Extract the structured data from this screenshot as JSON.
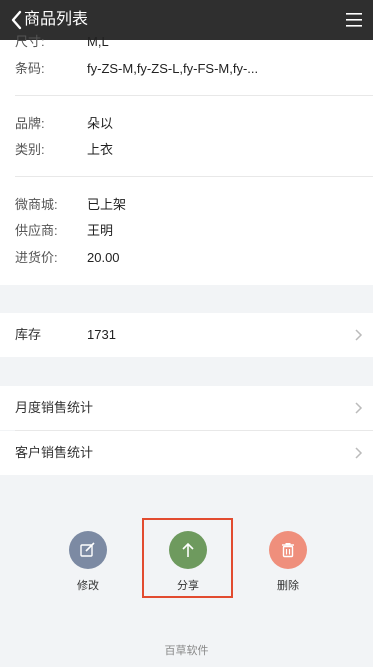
{
  "header": {
    "title": "商品列表",
    "back_icon": "chevron-left-icon",
    "menu_icon": "hamburger-menu-icon"
  },
  "details": {
    "size": {
      "label": "尺寸:",
      "value": "M,L"
    },
    "barcode": {
      "label": "条码:",
      "value": "fy-ZS-M,fy-ZS-L,fy-FS-M,fy-..."
    },
    "brand": {
      "label": "品牌:",
      "value": "朵以"
    },
    "category": {
      "label": "类别:",
      "value": "上衣"
    },
    "micro_mall": {
      "label": "微商城:",
      "value": "已上架"
    },
    "supplier": {
      "label": "供应商:",
      "value": "王明"
    },
    "purchase_price": {
      "label": "进货价:",
      "value": "20.00"
    }
  },
  "stock": {
    "label": "库存",
    "value": "1731"
  },
  "stats": {
    "monthly": {
      "label": "月度销售统计"
    },
    "customer": {
      "label": "客户销售统计"
    }
  },
  "actions": {
    "edit": {
      "label": "修改",
      "icon": "edit-icon",
      "color": "#7c8aa3"
    },
    "share": {
      "label": "分享",
      "icon": "arrow-up-icon",
      "color": "#6e9a5e"
    },
    "delete": {
      "label": "删除",
      "icon": "trash-icon",
      "color": "#ef8f7c"
    }
  },
  "highlight_color": "#e24b2f",
  "footer": {
    "text": "百草软件"
  }
}
